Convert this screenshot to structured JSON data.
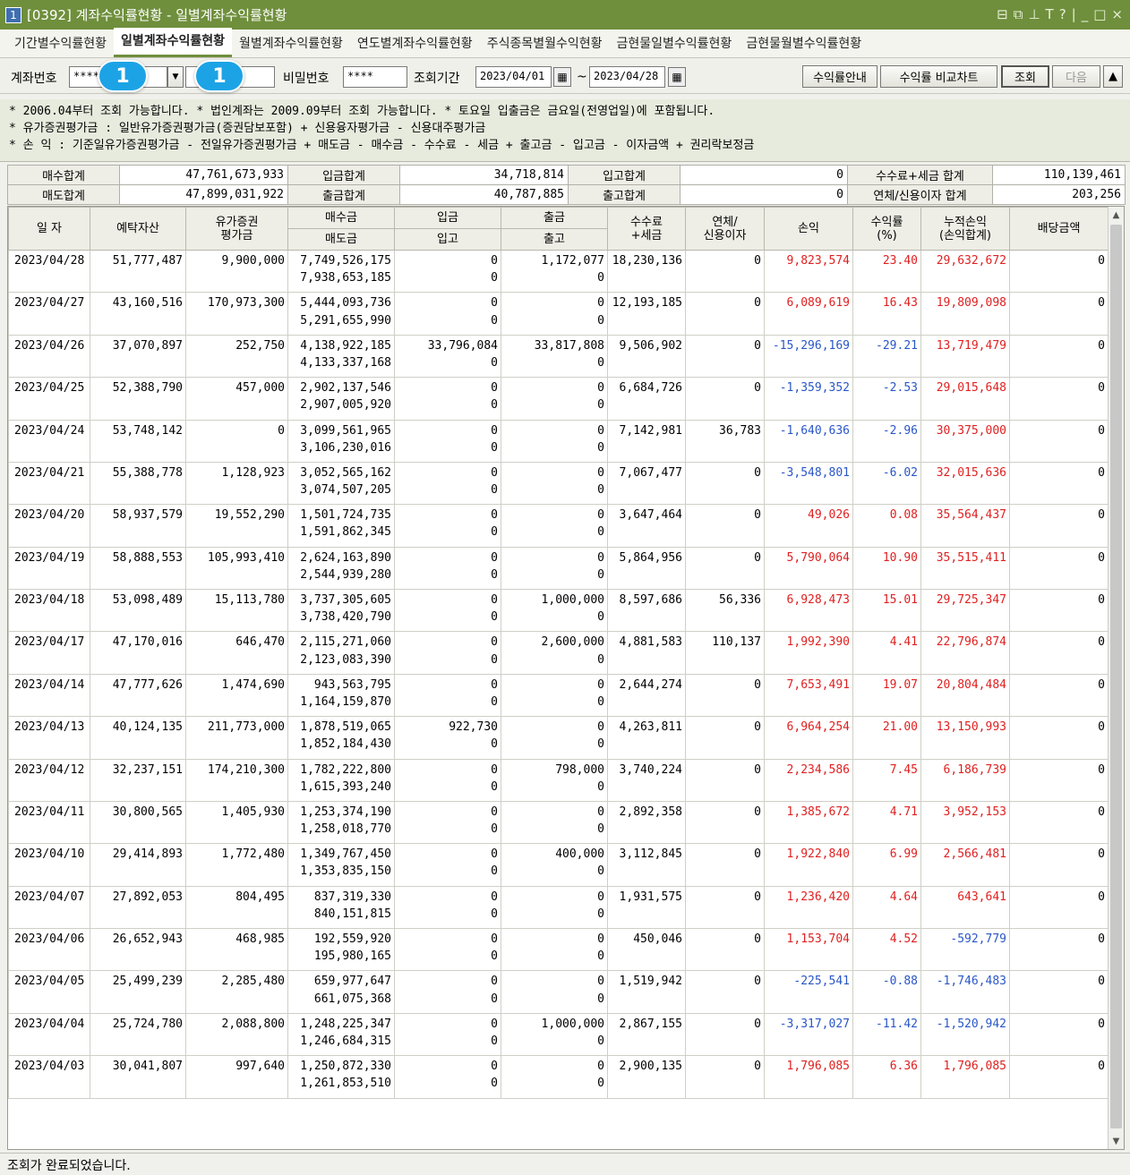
{
  "window": {
    "number": "1",
    "title": "[0392] 계좌수익률현황 - 일별계좌수익률현황",
    "controls": [
      "⊟",
      "⧉",
      "⊥",
      "T",
      "?",
      "|",
      "_",
      "□",
      "×"
    ]
  },
  "tabs": [
    "기간별수익률현황",
    "일별계좌수익률현황",
    "월별계좌수익률현황",
    "연도별계좌수익률현황",
    "주식종목별월수익현황",
    "금현물일별수익률현황",
    "금현물월별수익률현황"
  ],
  "query": {
    "account_label": "계좌번호",
    "account_value": "****",
    "password_label": "비밀번호",
    "password_value": "****",
    "period_label": "조회기간",
    "start_date": "2023/04/01",
    "tilde": "~",
    "end_date": "2023/04/28",
    "btn_guide": "수익률안내",
    "btn_compare": "수익률 비교차트",
    "btn_search": "조회",
    "btn_next": "다음",
    "btn_up": "▲",
    "badge1": "1",
    "badge2": "1"
  },
  "notes": [
    "* 2006.04부터 조회 가능합니다.   * 법인계좌는 2009.09부터 조회 가능합니다.   * 토요일 입출금은 금요일(전영업일)에 포함됩니다.",
    "* 유가증권평가금 : 일반유가증권평가금(증권담보포함) + 신용융자평가금 - 신용대주평가금",
    "* 손        익 : 기준일유가증권평가금 - 전일유가증권평가금 + 매도금 - 매수금 - 수수료 - 세금 + 출고금 - 입고금 - 이자금액 + 권리락보정금"
  ],
  "summary": {
    "row1": [
      "매수합계",
      "47,761,673,933",
      "입금합계",
      "34,718,814",
      "입고합계",
      "0",
      "수수료+세금 합계",
      "110,139,461"
    ],
    "row2": [
      "매도합계",
      "47,899,031,922",
      "출금합계",
      "40,787,885",
      "출고합계",
      "0",
      "연체/신용이자 합계",
      "203,256"
    ]
  },
  "headers": {
    "date": "일 자",
    "deposit": "예탁자산",
    "securities": "유가증권\n평가금",
    "buy": "매수금",
    "sell": "매도금",
    "in_cash": "입금",
    "in_stock": "입고",
    "out_cash": "출금",
    "out_stock": "출고",
    "fee": "수수료\n+세금",
    "interest": "연체/\n신용이자",
    "pnl": "손익",
    "rate": "수익률\n(%)",
    "cum": "누적손익\n(손익합계)",
    "dividend": "배당금액"
  },
  "rows": [
    {
      "date": "2023/04/28",
      "deposit": "51,777,487",
      "sec": "9,900,000",
      "buy": "7,749,526,175",
      "sell": "7,938,653,185",
      "in_cash": "0",
      "in_stock": "0",
      "out_cash": "1,172,077",
      "out_stock": "0",
      "fee": "18,230,136",
      "interest": "0",
      "pnl": "9,823,574",
      "rate": "23.40",
      "cum": "29,632,672",
      "div": "0",
      "pnl_sign": "pos",
      "rate_sign": "pos",
      "cum_sign": "pos"
    },
    {
      "date": "2023/04/27",
      "deposit": "43,160,516",
      "sec": "170,973,300",
      "buy": "5,444,093,736",
      "sell": "5,291,655,990",
      "in_cash": "0",
      "in_stock": "0",
      "out_cash": "0",
      "out_stock": "0",
      "fee": "12,193,185",
      "interest": "0",
      "pnl": "6,089,619",
      "rate": "16.43",
      "cum": "19,809,098",
      "div": "0",
      "pnl_sign": "pos",
      "rate_sign": "pos",
      "cum_sign": "pos"
    },
    {
      "date": "2023/04/26",
      "deposit": "37,070,897",
      "sec": "252,750",
      "buy": "4,138,922,185",
      "sell": "4,133,337,168",
      "in_cash": "33,796,084",
      "in_stock": "0",
      "out_cash": "33,817,808",
      "out_stock": "0",
      "fee": "9,506,902",
      "interest": "0",
      "pnl": "-15,296,169",
      "rate": "-29.21",
      "cum": "13,719,479",
      "div": "0",
      "pnl_sign": "neg",
      "rate_sign": "neg",
      "cum_sign": "pos"
    },
    {
      "date": "2023/04/25",
      "deposit": "52,388,790",
      "sec": "457,000",
      "buy": "2,902,137,546",
      "sell": "2,907,005,920",
      "in_cash": "0",
      "in_stock": "0",
      "out_cash": "0",
      "out_stock": "0",
      "fee": "6,684,726",
      "interest": "0",
      "pnl": "-1,359,352",
      "rate": "-2.53",
      "cum": "29,015,648",
      "div": "0",
      "pnl_sign": "neg",
      "rate_sign": "neg",
      "cum_sign": "pos"
    },
    {
      "date": "2023/04/24",
      "deposit": "53,748,142",
      "sec": "0",
      "buy": "3,099,561,965",
      "sell": "3,106,230,016",
      "in_cash": "0",
      "in_stock": "0",
      "out_cash": "0",
      "out_stock": "0",
      "fee": "7,142,981",
      "interest": "36,783",
      "pnl": "-1,640,636",
      "rate": "-2.96",
      "cum": "30,375,000",
      "div": "0",
      "pnl_sign": "neg",
      "rate_sign": "neg",
      "cum_sign": "pos"
    },
    {
      "date": "2023/04/21",
      "deposit": "55,388,778",
      "sec": "1,128,923",
      "buy": "3,052,565,162",
      "sell": "3,074,507,205",
      "in_cash": "0",
      "in_stock": "0",
      "out_cash": "0",
      "out_stock": "0",
      "fee": "7,067,477",
      "interest": "0",
      "pnl": "-3,548,801",
      "rate": "-6.02",
      "cum": "32,015,636",
      "div": "0",
      "pnl_sign": "neg",
      "rate_sign": "neg",
      "cum_sign": "pos"
    },
    {
      "date": "2023/04/20",
      "deposit": "58,937,579",
      "sec": "19,552,290",
      "buy": "1,501,724,735",
      "sell": "1,591,862,345",
      "in_cash": "0",
      "in_stock": "0",
      "out_cash": "0",
      "out_stock": "0",
      "fee": "3,647,464",
      "interest": "0",
      "pnl": "49,026",
      "rate": "0.08",
      "cum": "35,564,437",
      "div": "0",
      "pnl_sign": "pos",
      "rate_sign": "pos",
      "cum_sign": "pos"
    },
    {
      "date": "2023/04/19",
      "deposit": "58,888,553",
      "sec": "105,993,410",
      "buy": "2,624,163,890",
      "sell": "2,544,939,280",
      "in_cash": "0",
      "in_stock": "0",
      "out_cash": "0",
      "out_stock": "0",
      "fee": "5,864,956",
      "interest": "0",
      "pnl": "5,790,064",
      "rate": "10.90",
      "cum": "35,515,411",
      "div": "0",
      "pnl_sign": "pos",
      "rate_sign": "pos",
      "cum_sign": "pos"
    },
    {
      "date": "2023/04/18",
      "deposit": "53,098,489",
      "sec": "15,113,780",
      "buy": "3,737,305,605",
      "sell": "3,738,420,790",
      "in_cash": "0",
      "in_stock": "0",
      "out_cash": "1,000,000",
      "out_stock": "0",
      "fee": "8,597,686",
      "interest": "56,336",
      "pnl": "6,928,473",
      "rate": "15.01",
      "cum": "29,725,347",
      "div": "0",
      "pnl_sign": "pos",
      "rate_sign": "pos",
      "cum_sign": "pos"
    },
    {
      "date": "2023/04/17",
      "deposit": "47,170,016",
      "sec": "646,470",
      "buy": "2,115,271,060",
      "sell": "2,123,083,390",
      "in_cash": "0",
      "in_stock": "0",
      "out_cash": "2,600,000",
      "out_stock": "0",
      "fee": "4,881,583",
      "interest": "110,137",
      "pnl": "1,992,390",
      "rate": "4.41",
      "cum": "22,796,874",
      "div": "0",
      "pnl_sign": "pos",
      "rate_sign": "pos",
      "cum_sign": "pos"
    },
    {
      "date": "2023/04/14",
      "deposit": "47,777,626",
      "sec": "1,474,690",
      "buy": "943,563,795",
      "sell": "1,164,159,870",
      "in_cash": "0",
      "in_stock": "0",
      "out_cash": "0",
      "out_stock": "0",
      "fee": "2,644,274",
      "interest": "0",
      "pnl": "7,653,491",
      "rate": "19.07",
      "cum": "20,804,484",
      "div": "0",
      "pnl_sign": "pos",
      "rate_sign": "pos",
      "cum_sign": "pos"
    },
    {
      "date": "2023/04/13",
      "deposit": "40,124,135",
      "sec": "211,773,000",
      "buy": "1,878,519,065",
      "sell": "1,852,184,430",
      "in_cash": "922,730",
      "in_stock": "0",
      "out_cash": "0",
      "out_stock": "0",
      "fee": "4,263,811",
      "interest": "0",
      "pnl": "6,964,254",
      "rate": "21.00",
      "cum": "13,150,993",
      "div": "0",
      "pnl_sign": "pos",
      "rate_sign": "pos",
      "cum_sign": "pos"
    },
    {
      "date": "2023/04/12",
      "deposit": "32,237,151",
      "sec": "174,210,300",
      "buy": "1,782,222,800",
      "sell": "1,615,393,240",
      "in_cash": "0",
      "in_stock": "0",
      "out_cash": "798,000",
      "out_stock": "0",
      "fee": "3,740,224",
      "interest": "0",
      "pnl": "2,234,586",
      "rate": "7.45",
      "cum": "6,186,739",
      "div": "0",
      "pnl_sign": "pos",
      "rate_sign": "pos",
      "cum_sign": "pos"
    },
    {
      "date": "2023/04/11",
      "deposit": "30,800,565",
      "sec": "1,405,930",
      "buy": "1,253,374,190",
      "sell": "1,258,018,770",
      "in_cash": "0",
      "in_stock": "0",
      "out_cash": "0",
      "out_stock": "0",
      "fee": "2,892,358",
      "interest": "0",
      "pnl": "1,385,672",
      "rate": "4.71",
      "cum": "3,952,153",
      "div": "0",
      "pnl_sign": "pos",
      "rate_sign": "pos",
      "cum_sign": "pos"
    },
    {
      "date": "2023/04/10",
      "deposit": "29,414,893",
      "sec": "1,772,480",
      "buy": "1,349,767,450",
      "sell": "1,353,835,150",
      "in_cash": "0",
      "in_stock": "0",
      "out_cash": "400,000",
      "out_stock": "0",
      "fee": "3,112,845",
      "interest": "0",
      "pnl": "1,922,840",
      "rate": "6.99",
      "cum": "2,566,481",
      "div": "0",
      "pnl_sign": "pos",
      "rate_sign": "pos",
      "cum_sign": "pos"
    },
    {
      "date": "2023/04/07",
      "deposit": "27,892,053",
      "sec": "804,495",
      "buy": "837,319,330",
      "sell": "840,151,815",
      "in_cash": "0",
      "in_stock": "0",
      "out_cash": "0",
      "out_stock": "0",
      "fee": "1,931,575",
      "interest": "0",
      "pnl": "1,236,420",
      "rate": "4.64",
      "cum": "643,641",
      "div": "0",
      "pnl_sign": "pos",
      "rate_sign": "pos",
      "cum_sign": "pos"
    },
    {
      "date": "2023/04/06",
      "deposit": "26,652,943",
      "sec": "468,985",
      "buy": "192,559,920",
      "sell": "195,980,165",
      "in_cash": "0",
      "in_stock": "0",
      "out_cash": "0",
      "out_stock": "0",
      "fee": "450,046",
      "interest": "0",
      "pnl": "1,153,704",
      "rate": "4.52",
      "cum": "-592,779",
      "div": "0",
      "pnl_sign": "pos",
      "rate_sign": "pos",
      "cum_sign": "neg"
    },
    {
      "date": "2023/04/05",
      "deposit": "25,499,239",
      "sec": "2,285,480",
      "buy": "659,977,647",
      "sell": "661,075,368",
      "in_cash": "0",
      "in_stock": "0",
      "out_cash": "0",
      "out_stock": "0",
      "fee": "1,519,942",
      "interest": "0",
      "pnl": "-225,541",
      "rate": "-0.88",
      "cum": "-1,746,483",
      "div": "0",
      "pnl_sign": "neg",
      "rate_sign": "neg",
      "cum_sign": "neg"
    },
    {
      "date": "2023/04/04",
      "deposit": "25,724,780",
      "sec": "2,088,800",
      "buy": "1,248,225,347",
      "sell": "1,246,684,315",
      "in_cash": "0",
      "in_stock": "0",
      "out_cash": "1,000,000",
      "out_stock": "0",
      "fee": "2,867,155",
      "interest": "0",
      "pnl": "-3,317,027",
      "rate": "-11.42",
      "cum": "-1,520,942",
      "div": "0",
      "pnl_sign": "neg",
      "rate_sign": "neg",
      "cum_sign": "neg"
    },
    {
      "date": "2023/04/03",
      "deposit": "30,041,807",
      "sec": "997,640",
      "buy": "1,250,872,330",
      "sell": "1,261,853,510",
      "in_cash": "0",
      "in_stock": "0",
      "out_cash": "0",
      "out_stock": "0",
      "fee": "2,900,135",
      "interest": "0",
      "pnl": "1,796,085",
      "rate": "6.36",
      "cum": "1,796,085",
      "div": "0",
      "pnl_sign": "pos",
      "rate_sign": "pos",
      "cum_sign": "pos"
    }
  ],
  "status": "조회가 완료되었습니다.",
  "colors": {
    "title_bar": "#6f8f3c",
    "positive": "#e02020",
    "negative": "#2a56c8",
    "badge": "#1ca3e6"
  }
}
